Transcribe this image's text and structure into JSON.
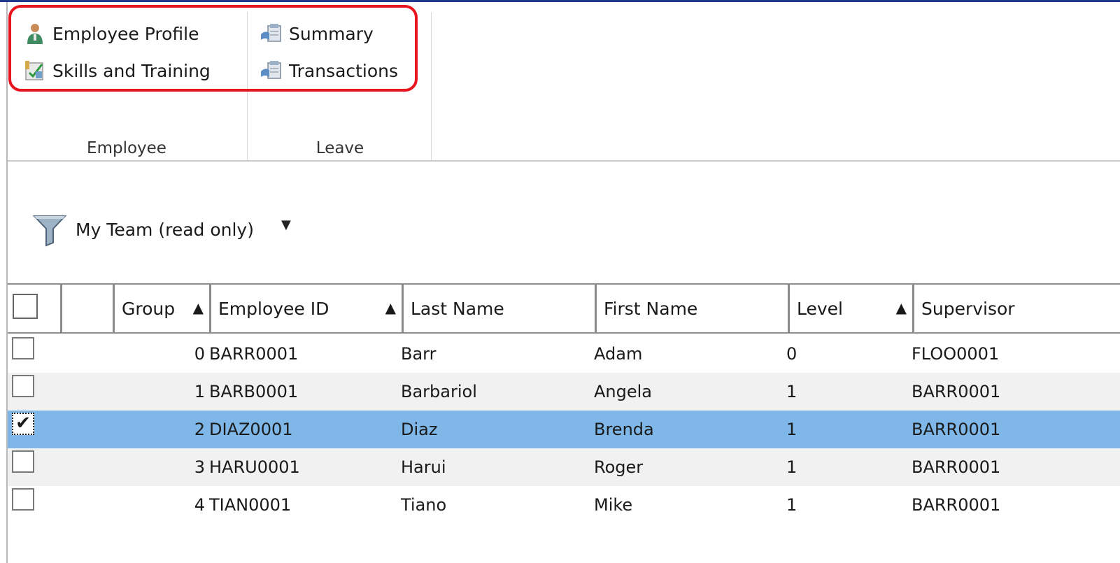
{
  "ribbon": {
    "employee_group": {
      "label": "Employee",
      "items": [
        {
          "label": "Employee Profile",
          "icon": "person-icon"
        },
        {
          "label": "Skills and Training",
          "icon": "skills-icon"
        }
      ]
    },
    "leave_group": {
      "label": "Leave",
      "items": [
        {
          "label": "Summary",
          "icon": "leave-summary-icon"
        },
        {
          "label": "Transactions",
          "icon": "leave-transactions-icon"
        }
      ]
    },
    "highlight_color": "#e8141e"
  },
  "filter": {
    "label": "My Team (read only)",
    "icon": "funnel-icon",
    "caret": "▼"
  },
  "grid": {
    "columns": [
      "Group",
      "Employee ID",
      "Last Name",
      "First Name",
      "Level",
      "Supervisor"
    ],
    "sort_indicator": "▲",
    "rows": [
      {
        "checked": false,
        "group": "0",
        "employee_id": "BARR0001",
        "last_name": "Barr",
        "first_name": "Adam",
        "level": "0",
        "supervisor": "FLOO0001"
      },
      {
        "checked": false,
        "group": "1",
        "employee_id": "BARB0001",
        "last_name": "Barbariol",
        "first_name": "Angela",
        "level": "1",
        "supervisor": "BARR0001"
      },
      {
        "checked": true,
        "group": "2",
        "employee_id": "DIAZ0001",
        "last_name": "Diaz",
        "first_name": "Brenda",
        "level": "1",
        "supervisor": "BARR0001"
      },
      {
        "checked": false,
        "group": "3",
        "employee_id": "HARU0001",
        "last_name": "Harui",
        "first_name": "Roger",
        "level": "1",
        "supervisor": "BARR0001"
      },
      {
        "checked": false,
        "group": "4",
        "employee_id": "TIAN0001",
        "last_name": "Tiano",
        "first_name": "Mike",
        "level": "1",
        "supervisor": "BARR0001"
      }
    ],
    "selected_row_color": "#7fb7e8",
    "check_mark": "✔"
  }
}
